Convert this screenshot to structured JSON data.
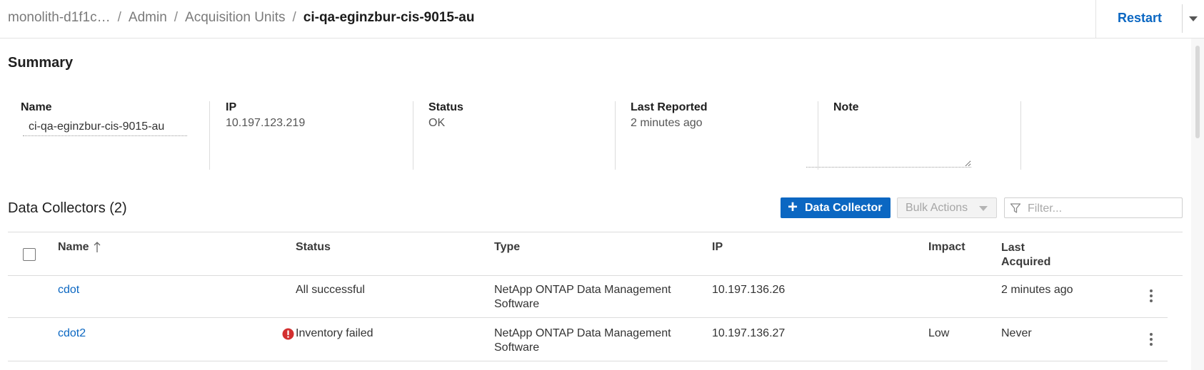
{
  "breadcrumb": {
    "items": [
      "monolith-d1f1c…",
      "Admin",
      "Acquisition Units"
    ],
    "current": "ci-qa-eginzbur-cis-9015-au",
    "separator": "/"
  },
  "header": {
    "restart_label": "Restart"
  },
  "summary": {
    "title": "Summary",
    "name_label": "Name",
    "name_value": "ci-qa-eginzbur-cis-9015-au",
    "ip_label": "IP",
    "ip_value": "10.197.123.219",
    "status_label": "Status",
    "status_value": "OK",
    "last_reported_label": "Last Reported",
    "last_reported_value": "2 minutes ago",
    "note_label": "Note",
    "note_value": ""
  },
  "collectors": {
    "title": "Data Collectors (2)",
    "add_label": "Data Collector",
    "bulk_label": "Bulk Actions",
    "filter_placeholder": "Filter...",
    "columns": {
      "name": "Name",
      "status": "Status",
      "type": "Type",
      "ip": "IP",
      "impact": "Impact",
      "last_acquired_1": "Last",
      "last_acquired_2": "Acquired"
    },
    "rows": [
      {
        "name": "cdot",
        "status": "All successful",
        "status_error": false,
        "type_1": "NetApp ONTAP Data Management",
        "type_2": "Software",
        "ip": "10.197.136.26",
        "impact": "",
        "last_acquired": "2 minutes ago"
      },
      {
        "name": "cdot2",
        "status": "Inventory failed",
        "status_error": true,
        "type_1": "NetApp ONTAP Data Management",
        "type_2": "Software",
        "ip": "10.197.136.27",
        "impact": "Low",
        "last_acquired": "Never"
      }
    ]
  },
  "colors": {
    "accent": "#0b67c2",
    "error": "#d32f2f"
  }
}
